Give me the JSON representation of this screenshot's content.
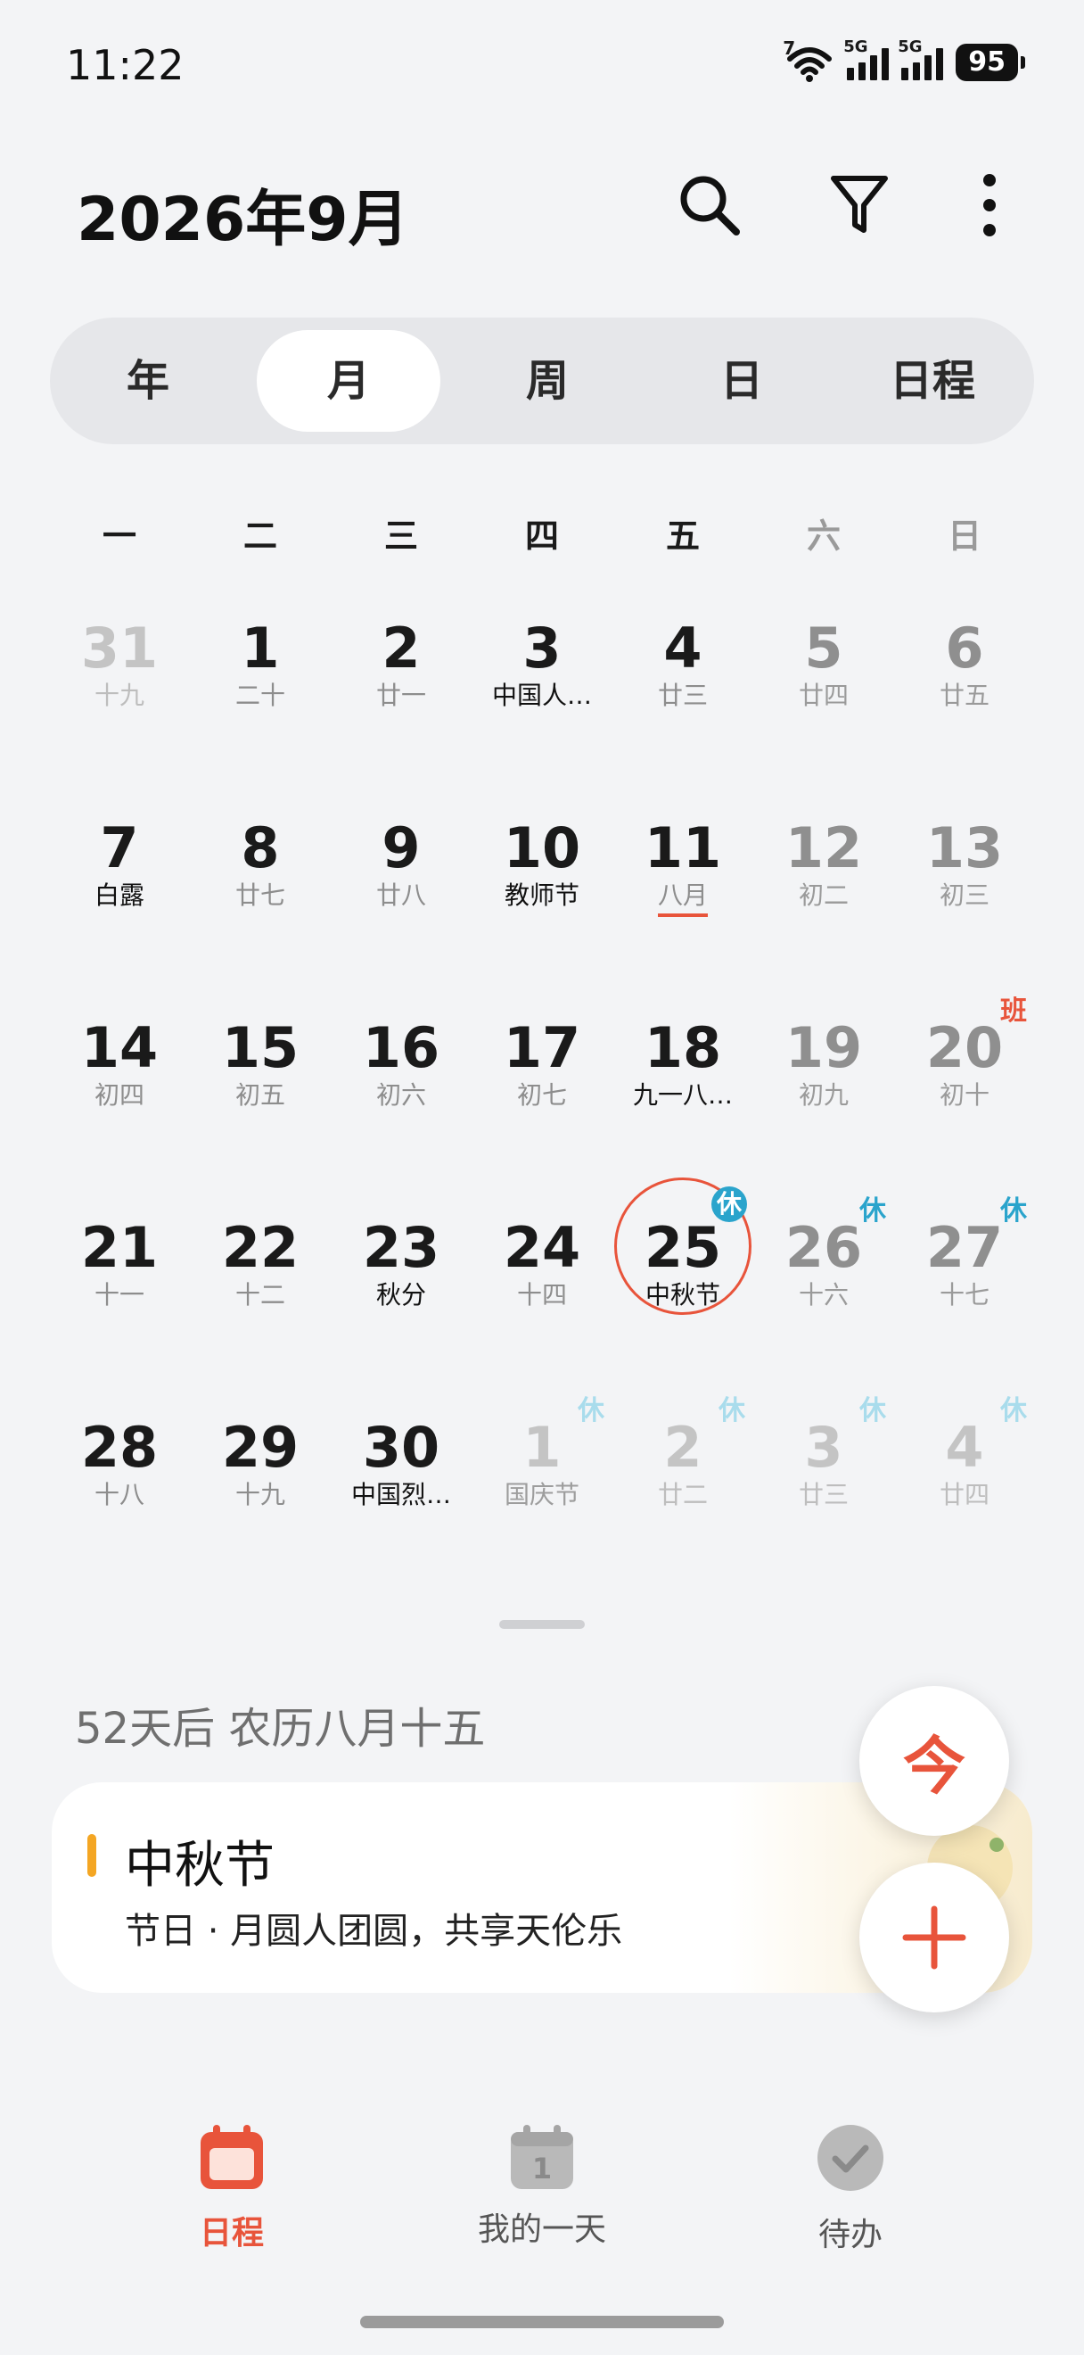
{
  "status_bar": {
    "time": "11:22",
    "wifi_label": "7",
    "signal1_label": "5G",
    "signal2_label": "5G",
    "battery": "95"
  },
  "header": {
    "title": "2026年9月",
    "icons": [
      "search-icon",
      "filter-icon",
      "more-icon"
    ]
  },
  "view_tabs": {
    "items": [
      "年",
      "月",
      "周",
      "日",
      "日程"
    ],
    "active": "月"
  },
  "weekdays": [
    "一",
    "二",
    "三",
    "四",
    "五",
    "六",
    "日"
  ],
  "calendar": {
    "weeks": [
      [
        {
          "day": "31",
          "sub": "十九",
          "faded": true
        },
        {
          "day": "1",
          "sub": "二十"
        },
        {
          "day": "2",
          "sub": "廿一"
        },
        {
          "day": "3",
          "sub": "中国人…",
          "fest": true
        },
        {
          "day": "4",
          "sub": "廿三"
        },
        {
          "day": "5",
          "sub": "廿四"
        },
        {
          "day": "6",
          "sub": "廿五"
        }
      ],
      [
        {
          "day": "7",
          "sub": "白露",
          "fest": true
        },
        {
          "day": "8",
          "sub": "廿七"
        },
        {
          "day": "9",
          "sub": "廿八"
        },
        {
          "day": "10",
          "sub": "教师节",
          "fest": true
        },
        {
          "day": "11",
          "sub": "八月",
          "today": true
        },
        {
          "day": "12",
          "sub": "初二"
        },
        {
          "day": "13",
          "sub": "初三"
        }
      ],
      [
        {
          "day": "14",
          "sub": "初四"
        },
        {
          "day": "15",
          "sub": "初五"
        },
        {
          "day": "16",
          "sub": "初六"
        },
        {
          "day": "17",
          "sub": "初七"
        },
        {
          "day": "18",
          "sub": "九一八…",
          "fest": true
        },
        {
          "day": "19",
          "sub": "初九"
        },
        {
          "day": "20",
          "sub": "初十",
          "badge": "班"
        }
      ],
      [
        {
          "day": "21",
          "sub": "十一"
        },
        {
          "day": "22",
          "sub": "十二"
        },
        {
          "day": "23",
          "sub": "秋分",
          "fest": true
        },
        {
          "day": "24",
          "sub": "十四"
        },
        {
          "day": "25",
          "sub": "中秋节",
          "fest": true,
          "selected": true,
          "badge": "休"
        },
        {
          "day": "26",
          "sub": "十六",
          "badge": "休"
        },
        {
          "day": "27",
          "sub": "十七",
          "badge": "休"
        }
      ],
      [
        {
          "day": "28",
          "sub": "十八"
        },
        {
          "day": "29",
          "sub": "十九"
        },
        {
          "day": "30",
          "sub": "中国烈…",
          "fest": true
        },
        {
          "day": "1",
          "sub": "国庆节",
          "fest": true,
          "faded": true,
          "badge": "休"
        },
        {
          "day": "2",
          "sub": "廿二",
          "faded": true,
          "badge": "休"
        },
        {
          "day": "3",
          "sub": "廿三",
          "faded": true,
          "badge": "休"
        },
        {
          "day": "4",
          "sub": "廿四",
          "faded": true,
          "badge": "休"
        }
      ]
    ]
  },
  "countdown": "52天后 农历八月十五",
  "event": {
    "title": "中秋节",
    "desc": "节日 · 月圆人团圆，共享天伦乐",
    "bar_color": "#f4a623"
  },
  "fab": {
    "today_label": "今",
    "add_icon": "plus-icon"
  },
  "bottom_nav": {
    "items": [
      {
        "label": "日程",
        "icon": "calendar-icon",
        "active": true
      },
      {
        "label": "我的一天",
        "icon": "my-day-calendar-icon",
        "icon_text": "1"
      },
      {
        "label": "待办",
        "icon": "checkmark-icon"
      }
    ]
  },
  "colors": {
    "accent": "#e8543b",
    "holiday": "#2aa4cc",
    "background": "#f3f4f6"
  }
}
